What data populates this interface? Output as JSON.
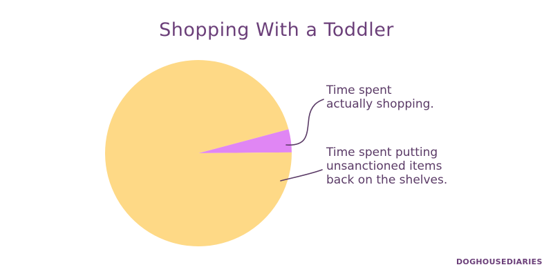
{
  "colors": {
    "title": "#6b3f79",
    "text": "#5a3a66",
    "leader": "#5a3a66",
    "background": "#ffffff"
  },
  "chart_data": {
    "type": "pie",
    "title": "Shopping With a Toddler",
    "slices": [
      {
        "label": "Time spent\nactually shopping.",
        "value": 4,
        "color": "#e086f4"
      },
      {
        "label": "Time spent putting\nunsanctioned items\nback on the shelves.",
        "value": 96,
        "color": "#fed986"
      }
    ],
    "legend": "none"
  },
  "watermark": "DOGHOUSEDIARIES"
}
